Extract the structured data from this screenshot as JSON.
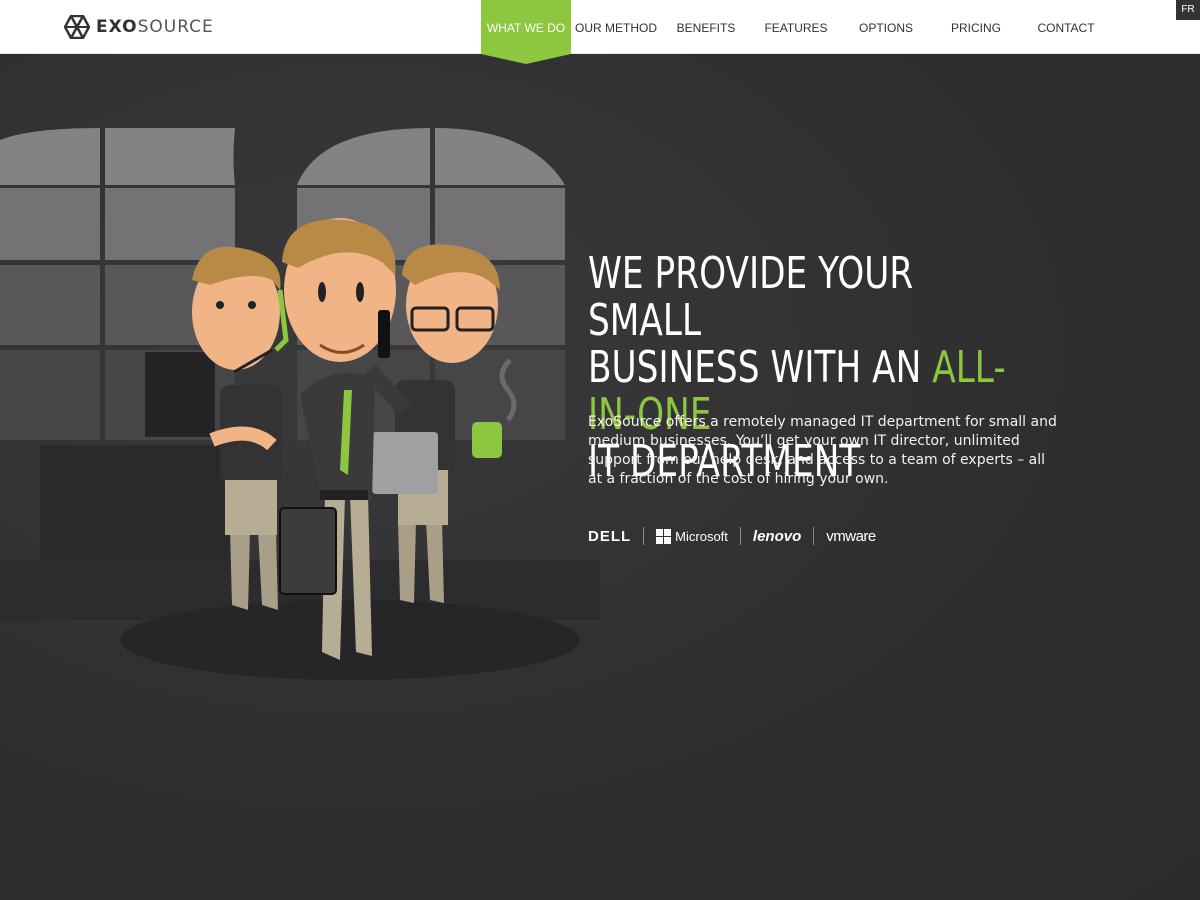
{
  "brand": {
    "logo_prefix": "EXO",
    "logo_suffix": "SOURCE"
  },
  "nav": {
    "items": [
      {
        "label": "WHAT WE DO",
        "active": true
      },
      {
        "label": "OUR METHOD",
        "active": false
      },
      {
        "label": "BENEFITS",
        "active": false
      },
      {
        "label": "FEATURES",
        "active": false
      },
      {
        "label": "OPTIONS",
        "active": false
      },
      {
        "label": "PRICING",
        "active": false
      },
      {
        "label": "CONTACT",
        "active": false
      }
    ],
    "language": "FR"
  },
  "hero": {
    "headline_line1": "WE PROVIDE YOUR SMALL",
    "headline_line2_prefix": "BUSINESS WITH AN ",
    "headline_highlight": "ALL-IN-ONE",
    "headline_line3": "IT DEPARTMENT",
    "description": "ExoSource offers a remotely managed IT department for small and medium businesses. You’ll get your own IT director, unlimited support from our help desk, and access to a team of experts – all at a fraction of the cost of hiring your own.",
    "partners": {
      "dell": "DELL",
      "microsoft": "Microsoft",
      "lenovo": "lenovo",
      "vmware": "vmware"
    }
  },
  "colors": {
    "accent": "#8dc63f",
    "background": "#2e2e30",
    "header": "#ffffff"
  },
  "icons": [
    "exosource-logo-icon",
    "microsoft-logo-icon"
  ]
}
